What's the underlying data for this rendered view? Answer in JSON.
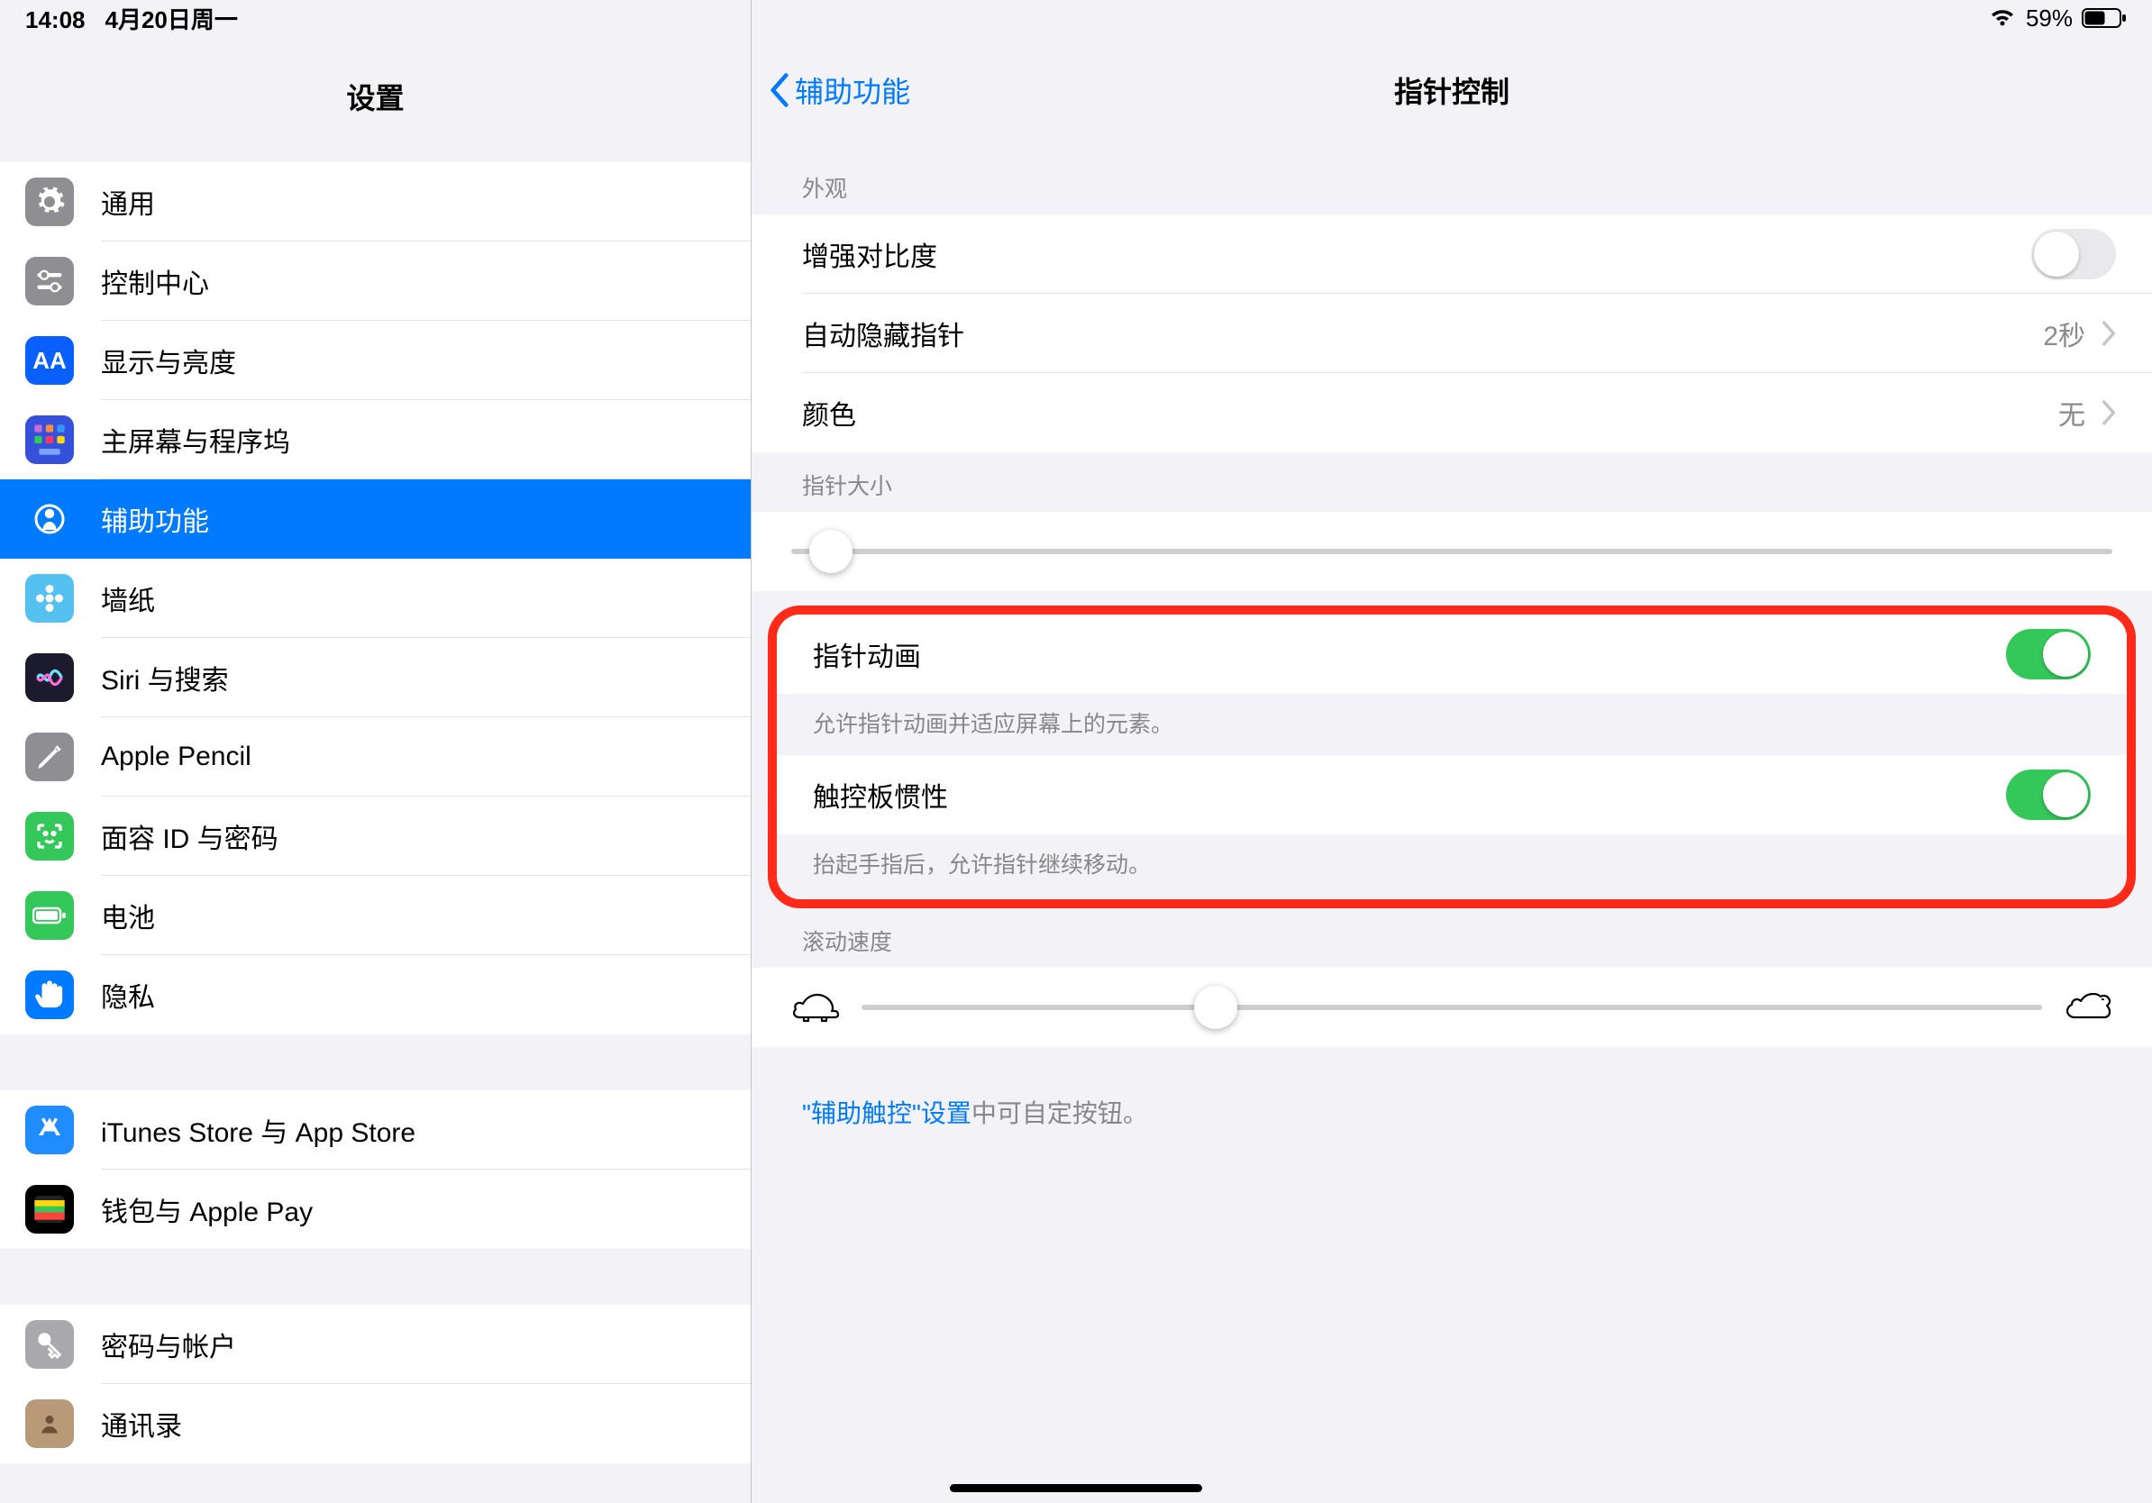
{
  "status": {
    "time": "14:08",
    "date": "4月20日周一",
    "battery_pct": "59%"
  },
  "sidebar_title": "设置",
  "groups": [
    {
      "items": [
        {
          "key": "general",
          "label": "通用",
          "icon": "gear",
          "bg": "#8e8e93"
        },
        {
          "key": "control",
          "label": "控制中心",
          "icon": "sliders",
          "bg": "#8e8e93"
        },
        {
          "key": "display",
          "label": "显示与亮度",
          "icon": "aa",
          "bg": "#0a60ff"
        },
        {
          "key": "home",
          "label": "主屏幕与程序坞",
          "icon": "grid",
          "bg": "#3551db"
        },
        {
          "key": "accessibility",
          "label": "辅助功能",
          "icon": "person",
          "bg": "#007aff",
          "selected": true
        },
        {
          "key": "wallpaper",
          "label": "墙纸",
          "icon": "flower",
          "bg": "#54c1f0"
        },
        {
          "key": "siri",
          "label": "Siri 与搜索",
          "icon": "siri",
          "bg": "#1b1b2d"
        },
        {
          "key": "pencil",
          "label": "Apple Pencil",
          "icon": "pencil",
          "bg": "#8e8e93"
        },
        {
          "key": "faceid",
          "label": "面容 ID 与密码",
          "icon": "face",
          "bg": "#34c759"
        },
        {
          "key": "battery",
          "label": "电池",
          "icon": "battery",
          "bg": "#34c759"
        },
        {
          "key": "privacy",
          "label": "隐私",
          "icon": "hand",
          "bg": "#007aff"
        }
      ]
    },
    {
      "items": [
        {
          "key": "itunes",
          "label": "iTunes Store 与 App Store",
          "icon": "appstore",
          "bg": "#1f8cff"
        },
        {
          "key": "wallet",
          "label": "钱包与 Apple Pay",
          "icon": "wallet",
          "bg": "#000"
        }
      ]
    },
    {
      "items": [
        {
          "key": "passwords",
          "label": "密码与帐户",
          "icon": "key",
          "bg": "#a8a8ad"
        },
        {
          "key": "contacts",
          "label": "通讯录",
          "icon": "contacts",
          "bg": "#b89a78"
        }
      ]
    }
  ],
  "detail": {
    "back_label": "辅助功能",
    "title": "指针控制",
    "sec_appearance": "外观",
    "rows_appearance": {
      "contrast": "增强对比度",
      "autohide": "自动隐藏指针",
      "autohide_value": "2秒",
      "color": "颜色",
      "color_value": "无"
    },
    "sec_size": "指针大小",
    "row_anim": "指针动画",
    "footer_anim": "允许指针动画并适应屏幕上的元素。",
    "row_inertia": "触控板惯性",
    "footer_inertia": "抬起手指后，允许指针继续移动。",
    "sec_speed": "滚动速度",
    "footer_link": "\"辅助触控\"设置",
    "footer_link_rest": "中可自定按钮。"
  },
  "slider_size_pct": 3,
  "slider_speed_pct": 30
}
